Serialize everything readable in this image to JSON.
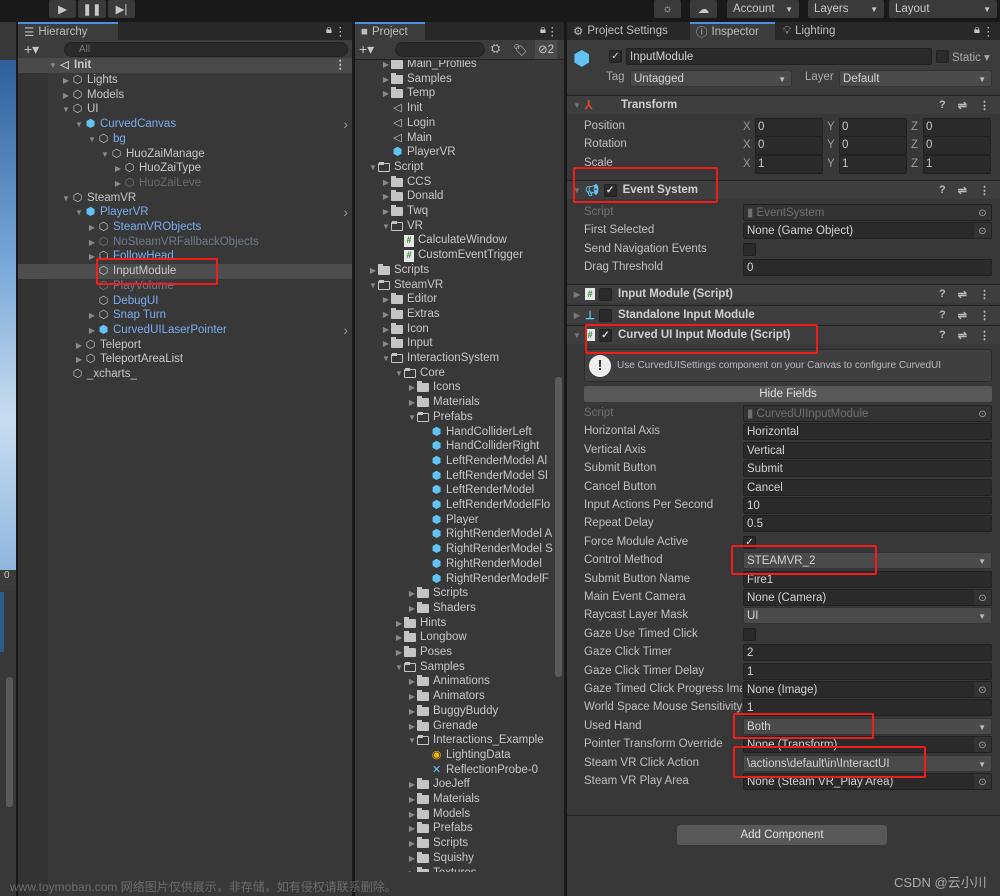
{
  "toolbar": {
    "play_icon": "play-icon",
    "pause_icon": "pause-icon",
    "step_icon": "step-icon",
    "account": "Account",
    "layers": "Layers",
    "layout": "Layout"
  },
  "hierarchy": {
    "tab": "Hierarchy",
    "search_placeholder": "All",
    "scene": "Init",
    "items": [
      {
        "label": "Lights",
        "depth": 1,
        "arrow": "right",
        "icon": "cube",
        "style": "normal"
      },
      {
        "label": "Models",
        "depth": 1,
        "arrow": "right",
        "icon": "cube",
        "style": "normal"
      },
      {
        "label": "UI",
        "depth": 1,
        "arrow": "down",
        "icon": "cube",
        "style": "normal"
      },
      {
        "label": "CurvedCanvas",
        "depth": 2,
        "arrow": "down",
        "icon": "prefab",
        "style": "prefab",
        "more": true
      },
      {
        "label": "bg",
        "depth": 3,
        "arrow": "down",
        "icon": "cube",
        "style": "prefab"
      },
      {
        "label": "HuoZaiManage",
        "depth": 4,
        "arrow": "down",
        "icon": "cube",
        "style": "normal"
      },
      {
        "label": "HuoZaiType",
        "depth": 5,
        "arrow": "right",
        "icon": "cube",
        "style": "normal"
      },
      {
        "label": "HuoZaiLeve",
        "depth": 5,
        "arrow": "right",
        "icon": "cube",
        "style": "disabled"
      },
      {
        "label": "SteamVR",
        "depth": 1,
        "arrow": "down",
        "icon": "cube",
        "style": "normal"
      },
      {
        "label": "PlayerVR",
        "depth": 2,
        "arrow": "down",
        "icon": "prefab",
        "style": "prefab",
        "more": true
      },
      {
        "label": "SteamVRObjects",
        "depth": 3,
        "arrow": "right",
        "icon": "cube",
        "style": "prefab"
      },
      {
        "label": "NoSteamVRFallbackObjects",
        "depth": 3,
        "arrow": "right",
        "icon": "cube",
        "style": "prefab-disabled"
      },
      {
        "label": "FollowHead",
        "depth": 3,
        "arrow": "right",
        "icon": "cube",
        "style": "prefab"
      },
      {
        "label": "InputModule",
        "depth": 3,
        "arrow": "",
        "icon": "cube",
        "style": "selected"
      },
      {
        "label": "PlayVolume",
        "depth": 3,
        "arrow": "",
        "icon": "cube",
        "style": "prefab-disabled"
      },
      {
        "label": "DebugUI",
        "depth": 3,
        "arrow": "",
        "icon": "cube",
        "style": "prefab"
      },
      {
        "label": "Snap Turn",
        "depth": 3,
        "arrow": "right",
        "icon": "cube",
        "style": "prefab"
      },
      {
        "label": "CurvedUILaserPointer",
        "depth": 3,
        "arrow": "right",
        "icon": "prefab",
        "style": "prefab",
        "more": true
      },
      {
        "label": "Teleport",
        "depth": 2,
        "arrow": "right",
        "icon": "cube",
        "style": "normal"
      },
      {
        "label": "TeleportAreaList",
        "depth": 2,
        "arrow": "right",
        "icon": "cube",
        "style": "normal"
      },
      {
        "label": "_xcharts_",
        "depth": 1,
        "arrow": "",
        "icon": "cube",
        "style": "normal"
      }
    ]
  },
  "side_panel": {
    "count": "0"
  },
  "project": {
    "tab": "Project",
    "hidden_count": "2",
    "items": [
      {
        "label": "Main_Profiles",
        "depth": 1,
        "arrow": "right",
        "icon": "folder"
      },
      {
        "label": "Samples",
        "depth": 1,
        "arrow": "right",
        "icon": "folder"
      },
      {
        "label": "Temp",
        "depth": 1,
        "arrow": "right",
        "icon": "folder"
      },
      {
        "label": "Init",
        "depth": 1,
        "arrow": "",
        "icon": "scene"
      },
      {
        "label": "Login",
        "depth": 1,
        "arrow": "",
        "icon": "scene"
      },
      {
        "label": "Main",
        "depth": 1,
        "arrow": "",
        "icon": "scene"
      },
      {
        "label": "PlayerVR",
        "depth": 1,
        "arrow": "",
        "icon": "prefab"
      },
      {
        "label": "Script",
        "depth": 0,
        "arrow": "down",
        "icon": "folder-open"
      },
      {
        "label": "CCS",
        "depth": 1,
        "arrow": "right",
        "icon": "folder"
      },
      {
        "label": "Donald",
        "depth": 1,
        "arrow": "right",
        "icon": "folder"
      },
      {
        "label": "Twq",
        "depth": 1,
        "arrow": "right",
        "icon": "folder"
      },
      {
        "label": "VR",
        "depth": 1,
        "arrow": "down",
        "icon": "folder-open"
      },
      {
        "label": "CalculateWindow",
        "depth": 2,
        "arrow": "",
        "icon": "script"
      },
      {
        "label": "CustomEventTrigger",
        "depth": 2,
        "arrow": "",
        "icon": "script"
      },
      {
        "label": "Scripts",
        "depth": 0,
        "arrow": "right",
        "icon": "folder"
      },
      {
        "label": "SteamVR",
        "depth": 0,
        "arrow": "down",
        "icon": "folder-open"
      },
      {
        "label": "Editor",
        "depth": 1,
        "arrow": "right",
        "icon": "folder"
      },
      {
        "label": "Extras",
        "depth": 1,
        "arrow": "right",
        "icon": "folder"
      },
      {
        "label": "Icon",
        "depth": 1,
        "arrow": "right",
        "icon": "folder"
      },
      {
        "label": "Input",
        "depth": 1,
        "arrow": "right",
        "icon": "folder"
      },
      {
        "label": "InteractionSystem",
        "depth": 1,
        "arrow": "down",
        "icon": "folder-open"
      },
      {
        "label": "Core",
        "depth": 2,
        "arrow": "down",
        "icon": "folder-open"
      },
      {
        "label": "Icons",
        "depth": 3,
        "arrow": "right",
        "icon": "folder"
      },
      {
        "label": "Materials",
        "depth": 3,
        "arrow": "right",
        "icon": "folder"
      },
      {
        "label": "Prefabs",
        "depth": 3,
        "arrow": "down",
        "icon": "folder-open"
      },
      {
        "label": "HandColliderLeft",
        "depth": 4,
        "arrow": "",
        "icon": "prefab"
      },
      {
        "label": "HandColliderRight",
        "depth": 4,
        "arrow": "",
        "icon": "prefab"
      },
      {
        "label": "LeftRenderModel Al",
        "depth": 4,
        "arrow": "",
        "icon": "prefab"
      },
      {
        "label": "LeftRenderModel Sl",
        "depth": 4,
        "arrow": "",
        "icon": "prefab"
      },
      {
        "label": "LeftRenderModel",
        "depth": 4,
        "arrow": "",
        "icon": "prefab"
      },
      {
        "label": "LeftRenderModelFlo",
        "depth": 4,
        "arrow": "",
        "icon": "prefab"
      },
      {
        "label": "Player",
        "depth": 4,
        "arrow": "",
        "icon": "prefab"
      },
      {
        "label": "RightRenderModel A",
        "depth": 4,
        "arrow": "",
        "icon": "prefab"
      },
      {
        "label": "RightRenderModel S",
        "depth": 4,
        "arrow": "",
        "icon": "prefab"
      },
      {
        "label": "RightRenderModel",
        "depth": 4,
        "arrow": "",
        "icon": "prefab"
      },
      {
        "label": "RightRenderModelF",
        "depth": 4,
        "arrow": "",
        "icon": "prefab"
      },
      {
        "label": "Scripts",
        "depth": 3,
        "arrow": "right",
        "icon": "folder"
      },
      {
        "label": "Shaders",
        "depth": 3,
        "arrow": "right",
        "icon": "folder"
      },
      {
        "label": "Hints",
        "depth": 2,
        "arrow": "right",
        "icon": "folder"
      },
      {
        "label": "Longbow",
        "depth": 2,
        "arrow": "right",
        "icon": "folder"
      },
      {
        "label": "Poses",
        "depth": 2,
        "arrow": "right",
        "icon": "folder"
      },
      {
        "label": "Samples",
        "depth": 2,
        "arrow": "down",
        "icon": "folder-open"
      },
      {
        "label": "Animations",
        "depth": 3,
        "arrow": "right",
        "icon": "folder"
      },
      {
        "label": "Animators",
        "depth": 3,
        "arrow": "right",
        "icon": "folder"
      },
      {
        "label": "BuggyBuddy",
        "depth": 3,
        "arrow": "right",
        "icon": "folder"
      },
      {
        "label": "Grenade",
        "depth": 3,
        "arrow": "right",
        "icon": "folder"
      },
      {
        "label": "Interactions_Example",
        "depth": 3,
        "arrow": "down",
        "icon": "folder-open"
      },
      {
        "label": "LightingData",
        "depth": 4,
        "arrow": "",
        "icon": "lighting"
      },
      {
        "label": "ReflectionProbe-0",
        "depth": 4,
        "arrow": "",
        "icon": "probe"
      },
      {
        "label": "JoeJeff",
        "depth": 3,
        "arrow": "right",
        "icon": "folder"
      },
      {
        "label": "Materials",
        "depth": 3,
        "arrow": "right",
        "icon": "folder"
      },
      {
        "label": "Models",
        "depth": 3,
        "arrow": "right",
        "icon": "folder"
      },
      {
        "label": "Prefabs",
        "depth": 3,
        "arrow": "right",
        "icon": "folder"
      },
      {
        "label": "Scripts",
        "depth": 3,
        "arrow": "right",
        "icon": "folder"
      },
      {
        "label": "Squishy",
        "depth": 3,
        "arrow": "right",
        "icon": "folder"
      },
      {
        "label": "Textures",
        "depth": 3,
        "arrow": "right",
        "icon": "folder"
      }
    ]
  },
  "inspector": {
    "tabs": [
      "Project Settings",
      "Inspector",
      "Lighting"
    ],
    "object_name": "InputModule",
    "active": true,
    "static_label": "Static",
    "tag_label": "Tag",
    "tag": "Untagged",
    "layer_label": "Layer",
    "layer": "Default",
    "transform": {
      "title": "Transform",
      "rows": [
        {
          "label": "Position",
          "x": "0",
          "y": "0",
          "z": "0"
        },
        {
          "label": "Rotation",
          "x": "0",
          "y": "0",
          "z": "0"
        },
        {
          "label": "Scale",
          "x": "1",
          "y": "1",
          "z": "1"
        }
      ]
    },
    "event_system": {
      "title": "Event System",
      "enabled": true,
      "fields": [
        {
          "label": "Script",
          "value": "EventSystem",
          "kind": "script"
        },
        {
          "label": "First Selected",
          "value": "None (Game Object)",
          "kind": "object"
        },
        {
          "label": "Send Navigation Events",
          "value": "",
          "kind": "checkbox",
          "checked": false
        },
        {
          "label": "Drag Threshold",
          "value": "0",
          "kind": "text"
        }
      ]
    },
    "input_module": {
      "title": "Input Module (Script)",
      "enabled": false
    },
    "standalone": {
      "title": "Standalone Input Module",
      "enabled": false
    },
    "curved": {
      "title": "Curved UI Input Module (Script)",
      "enabled": true,
      "help": "Use CurvedUISettings component on your Canvas to configure CurvedUI",
      "hide_fields": "Hide Fields",
      "fields": [
        {
          "label": "Script",
          "value": "CurvedUIInputModule",
          "kind": "script"
        },
        {
          "label": "Horizontal Axis",
          "value": "Horizontal",
          "kind": "text"
        },
        {
          "label": "Vertical Axis",
          "value": "Vertical",
          "kind": "text"
        },
        {
          "label": "Submit Button",
          "value": "Submit",
          "kind": "text"
        },
        {
          "label": "Cancel Button",
          "value": "Cancel",
          "kind": "text"
        },
        {
          "label": "Input Actions Per Second",
          "value": "10",
          "kind": "text"
        },
        {
          "label": "Repeat Delay",
          "value": "0.5",
          "kind": "text"
        },
        {
          "label": "Force Module Active",
          "value": "",
          "kind": "checkbox",
          "checked": true
        },
        {
          "label": "Control Method",
          "value": "STEAMVR_2",
          "kind": "dropdown"
        },
        {
          "label": "Submit Button Name",
          "value": "Fire1",
          "kind": "text"
        },
        {
          "label": "Main Event Camera",
          "value": "None (Camera)",
          "kind": "object"
        },
        {
          "label": "Raycast Layer Mask",
          "value": "UI",
          "kind": "dropdown"
        },
        {
          "label": "Gaze Use Timed Click",
          "value": "",
          "kind": "checkbox",
          "checked": false
        },
        {
          "label": "Gaze Click Timer",
          "value": "2",
          "kind": "text"
        },
        {
          "label": "Gaze Click Timer Delay",
          "value": "1",
          "kind": "text"
        },
        {
          "label": "Gaze Timed Click Progress Ima",
          "value": "None (Image)",
          "kind": "object"
        },
        {
          "label": "World Space Mouse Sensitivity",
          "value": "1",
          "kind": "text"
        },
        {
          "label": "Used Hand",
          "value": "Both",
          "kind": "dropdown"
        },
        {
          "label": "Pointer Transform Override",
          "value": "None (Transform)",
          "kind": "object"
        },
        {
          "label": "Steam VR Click Action",
          "value": "\\actions\\default\\in\\InteractUI",
          "kind": "dropdown"
        },
        {
          "label": "Steam VR Play Area",
          "value": "None (Steam VR_Play Area)",
          "kind": "object"
        }
      ]
    },
    "add_component": "Add Component"
  },
  "watermarks": {
    "csdn": "CSDN @云小川",
    "site": "www.toymoban.com 网络图片仅供展示，非存储，如有侵权请联系删除。"
  },
  "colors": {
    "highlight_box": "#f01d1d",
    "prefab_text": "#7cacf0",
    "prefab_icon": "#62c3f5",
    "panel_bg": "#383838"
  }
}
